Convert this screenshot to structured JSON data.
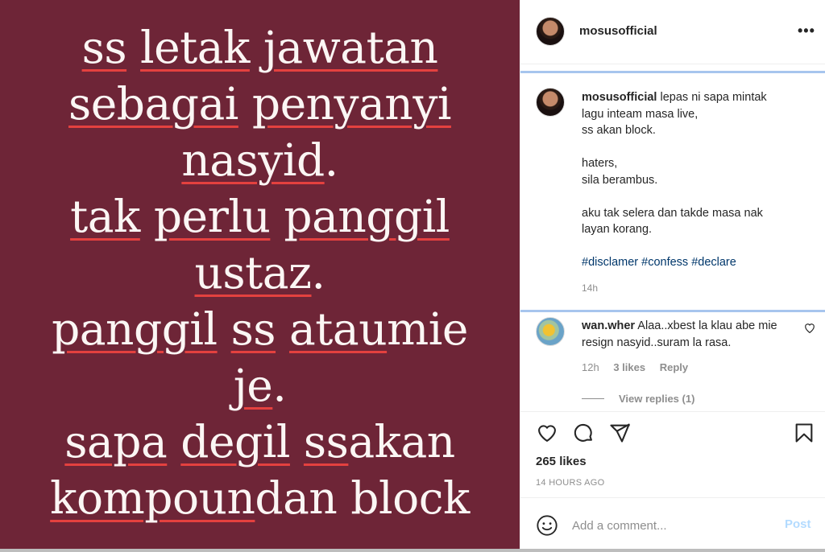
{
  "post_image": {
    "lines": [
      [
        {
          "t": "ss",
          "u": true
        },
        {
          "t": " "
        },
        {
          "t": "letak",
          "u": true
        },
        {
          "t": " "
        },
        {
          "t": "jawatan",
          "u": true
        }
      ],
      [
        {
          "t": "sebagai",
          "u": true
        },
        {
          "t": " "
        },
        {
          "t": "penyanyi",
          "u": true
        }
      ],
      [
        {
          "t": "nasyid",
          "u": true
        },
        {
          "t": "."
        }
      ],
      [
        {
          "t": "tak",
          "u": true
        },
        {
          "t": " "
        },
        {
          "t": "perlu",
          "u": true
        },
        {
          "t": " "
        },
        {
          "t": "panggil",
          "u": true
        }
      ],
      [
        {
          "t": "ustaz",
          "u": true
        },
        {
          "t": "."
        }
      ],
      [
        {
          "t": "panggil",
          "u": true
        },
        {
          "t": " "
        },
        {
          "t": "ss",
          "u": true
        },
        {
          "t": " "
        },
        {
          "t": "atau",
          "u": true
        },
        {
          "t": " mie"
        }
      ],
      [
        {
          "t": "je",
          "u": true
        },
        {
          "t": "."
        }
      ],
      [
        {
          "t": "sapa",
          "u": true
        },
        {
          "t": " "
        },
        {
          "t": "degil",
          "u": true
        },
        {
          "t": " "
        },
        {
          "t": "ss",
          "u": true
        },
        {
          "t": " akan"
        }
      ],
      [
        {
          "t": "kompoun",
          "u": true
        },
        {
          "t": " dan block"
        }
      ]
    ],
    "background": "#6e2537",
    "underline_color": "#e4413f"
  },
  "header": {
    "username": "mosusofficial",
    "more_icon": "more-horizontal-icon"
  },
  "caption": {
    "username": "mosusofficial",
    "line1": " lepas ni sapa mintak",
    "line2": "lagu inteam masa live,",
    "line3": "ss akan block.",
    "line4": "haters,",
    "line5": "sila berambus.",
    "line6": "aku tak selera dan takde masa nak",
    "line7": "layan korang.",
    "hashtags": "#disclamer #confess #declare",
    "time": "14h"
  },
  "comment": {
    "username": "wan.wher",
    "text": " Alaa..xbest la klau abe mie resign nasyid..suram la rasa.",
    "time": "12h",
    "likes": "3 likes",
    "reply": "Reply",
    "view_replies": "View replies (1)"
  },
  "actions": {
    "likes": "265 likes",
    "posted": "14 HOURS AGO"
  },
  "add_comment": {
    "placeholder": "Add a comment...",
    "post": "Post"
  }
}
